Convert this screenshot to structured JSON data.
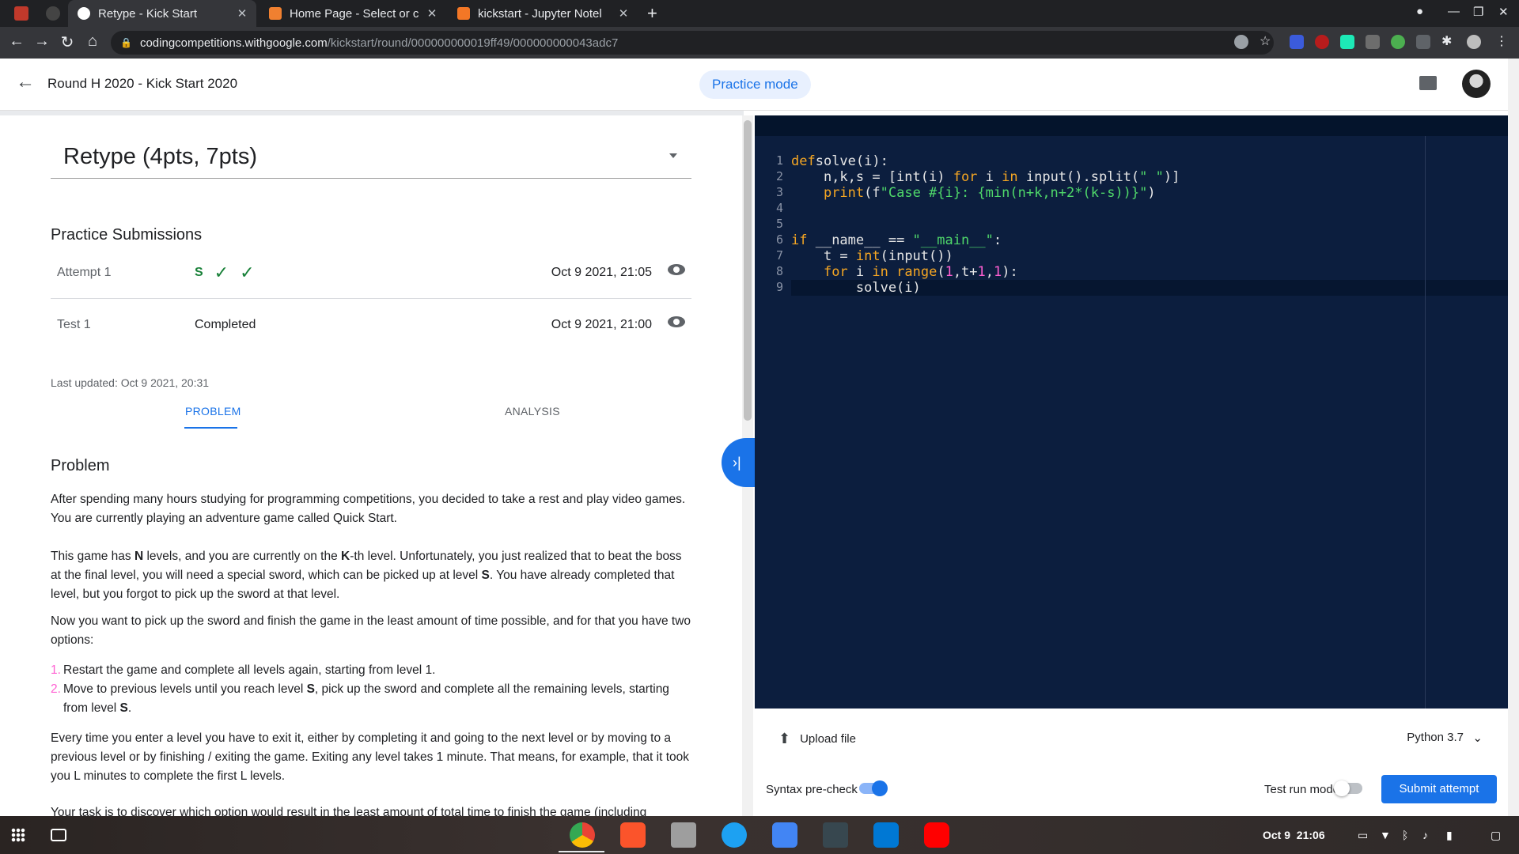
{
  "browser": {
    "tabs": [
      {
        "title": "Retype - Kick Start",
        "active": true
      },
      {
        "title": "Home Page - Select or c",
        "active": false
      },
      {
        "title": "kickstart - Jupyter Notel",
        "active": false
      }
    ],
    "url_host": "codingcompetitions.withgoogle.com",
    "url_path": "/kickstart/round/000000000019ff49/000000000043adc7"
  },
  "header": {
    "round_title": "Round H 2020 - Kick Start 2020",
    "mode_label": "Practice mode"
  },
  "problem_selector": {
    "label": "Retype (4pts, 7pts)"
  },
  "submissions": {
    "title": "Practice Submissions",
    "rows": [
      {
        "name": "Attempt 1",
        "status_letter": "S",
        "date": "Oct 9 2021, 21:05"
      },
      {
        "name": "Test 1",
        "status": "Completed",
        "date": "Oct 9 2021, 21:00"
      }
    ]
  },
  "last_updated": "Last updated: Oct 9 2021, 20:31",
  "tabs": {
    "problem": "PROBLEM",
    "analysis": "ANALYSIS"
  },
  "problem": {
    "heading": "Problem",
    "p1": "After spending many hours studying for programming competitions, you decided to take a rest and play video games. You are currently playing an adventure game called Quick Start.",
    "p2_a": "This game has ",
    "p2_N": "N",
    "p2_b": " levels, and you are currently on the ",
    "p2_K": "K",
    "p2_c": "-th level. Unfortunately, you just realized that to beat the boss at the final level, you will need a special sword, which can be picked up at level ",
    "p2_S": "S",
    "p2_d": ". You have already completed that level, but you forgot to pick up the sword at that level.",
    "p3": "Now you want to pick up the sword and finish the game in the least amount of time possible, and for that you have two options:",
    "li1": "Restart the game and complete all levels again, starting from level 1.",
    "li2_a": "Move to previous levels until you reach level ",
    "li2_S": "S",
    "li2_b": ", pick up the sword and complete all the remaining levels, starting from level ",
    "li2_S2": "S",
    "li2_c": ".",
    "p4": "Every time you enter a level you have to exit it, either by completing it and going to the next level or by moving to a previous level or by finishing / exiting the game. Exiting any level takes 1 minute. That means, for example, that it took you L minutes to complete the first L levels.",
    "p5": "Your task is to discover which option would result in the least amount of total time to finish the game (including"
  },
  "editor": {
    "line_numbers": [
      "1",
      "2",
      "3",
      "4",
      "5",
      "6",
      "7",
      "8",
      "9"
    ],
    "upload_label": "Upload file",
    "language": "Python 3.7",
    "syntax_label": "Syntax pre-check",
    "syntax_on": true,
    "testrun_label": "Test run mode",
    "testrun_on": false,
    "submit_label": "Submit attempt"
  },
  "shelf": {
    "date": "Oct 9",
    "time": "21:06"
  },
  "colors": {
    "accent": "#1a73e8",
    "editor_bg": "#0c1e3e",
    "success": "#188038"
  }
}
